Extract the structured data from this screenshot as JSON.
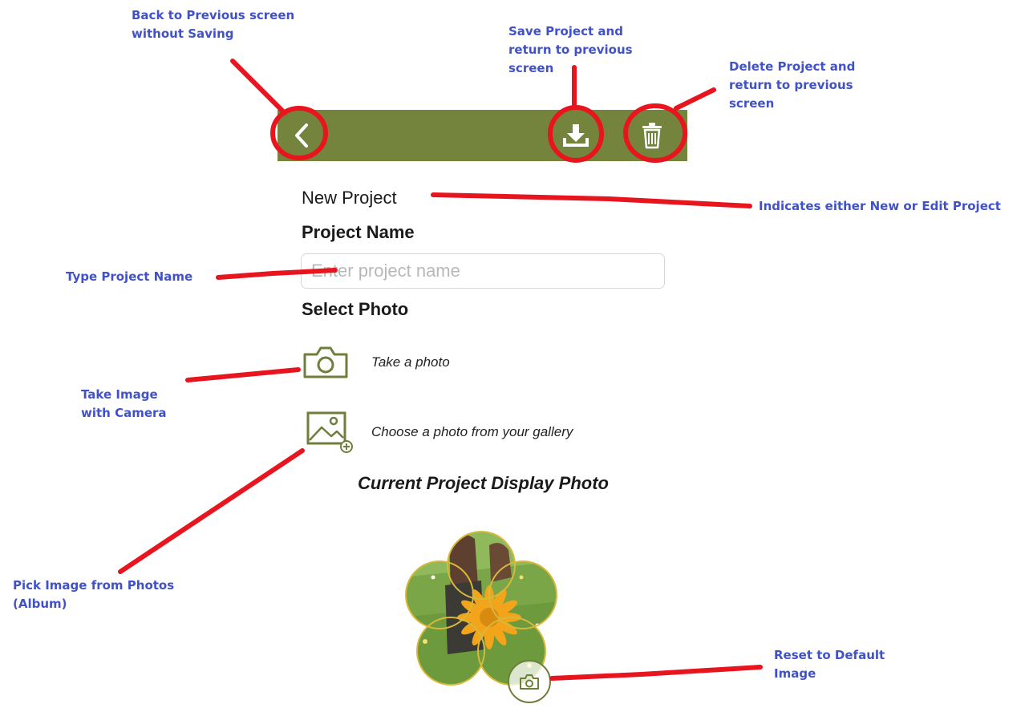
{
  "annotations": {
    "back": "Back to Previous screen\nwithout Saving",
    "save": "Save Project and\nreturn to previous\nscreen",
    "delete": "Delete Project and\nreturn to previous\nscreen",
    "title": "Indicates either New or Edit Project",
    "name": "Type Project Name",
    "camera": "Take Image\nwith Camera",
    "album": "Pick Image from Photos\n(Album)",
    "reset": "Reset to Default\nImage"
  },
  "toolbar": {
    "background_color": "#74843d",
    "back_icon": "chevron-left-icon",
    "save_icon": "download-icon",
    "delete_icon": "trash-icon"
  },
  "form": {
    "page_title": "New Project",
    "name_label": "Project Name",
    "name_value": "",
    "name_placeholder": "Enter project name",
    "select_photo_label": "Select Photo",
    "take_photo_label": "Take a photo",
    "gallery_label": "Choose a photo from your gallery",
    "current_photo_heading": "Current Project Display Photo"
  },
  "colors": {
    "accent": "#74843d",
    "annotation_text": "#4152c8",
    "annotation_marker": "#e8141e"
  }
}
